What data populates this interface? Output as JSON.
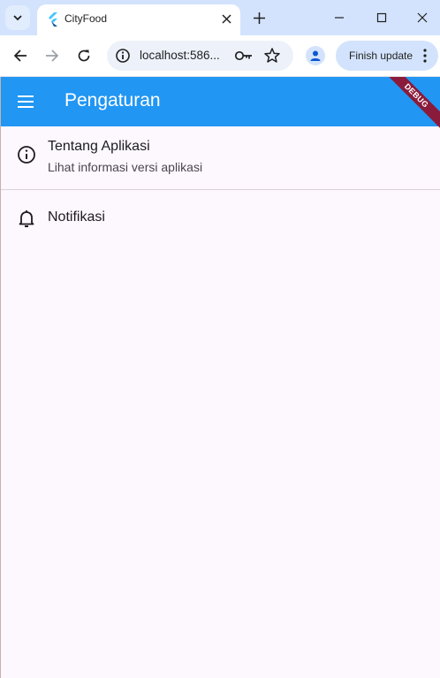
{
  "browser": {
    "tab_title": "CityFood",
    "address": "localhost:586...",
    "update_button": "Finish update",
    "icons": {
      "tab_search": "chevron-down-icon",
      "favicon": "flutter-icon",
      "close_tab": "close-icon",
      "new_tab": "plus-icon",
      "back": "back-arrow-icon",
      "forward": "forward-arrow-icon",
      "reload": "reload-icon",
      "site_info": "info-icon",
      "password": "key-icon",
      "bookmark": "star-icon",
      "profile": "person-icon",
      "menu": "more-vert-icon"
    }
  },
  "app": {
    "title": "Pengaturan",
    "debug_banner": "DEBUG",
    "appbar_color": "#2196f3",
    "background": "#fdf7fe",
    "items": [
      {
        "title": "Tentang Aplikasi",
        "subtitle": "Lihat informasi versi aplikasi",
        "icon": "info-outline-icon"
      },
      {
        "title": "Notifikasi",
        "icon": "bell-icon"
      }
    ]
  }
}
